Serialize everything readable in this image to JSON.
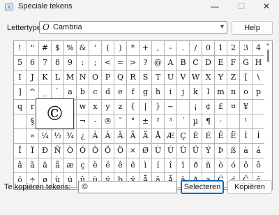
{
  "window": {
    "title": "Speciale tekens",
    "minimize_icon": "minimize-icon",
    "maximize_icon": "maximize-icon",
    "close_icon": "close-icon"
  },
  "font": {
    "label": "Lettertype:",
    "value": "Cambria",
    "font_type_glyph": "O",
    "dropdown_icon": "chevron-down-icon"
  },
  "help": {
    "label": "Help"
  },
  "grid": {
    "columns": 20,
    "rows": [
      [
        "!",
        "\"",
        "#",
        "$",
        "%",
        "&",
        "'",
        "(",
        ")",
        "*",
        "+",
        ",",
        "-",
        ".",
        "/",
        "0",
        "1",
        "2",
        "3",
        "4"
      ],
      [
        "5",
        "6",
        "7",
        "8",
        "9",
        ":",
        ";",
        "<",
        "=",
        ">",
        "?",
        "@",
        "A",
        "B",
        "C",
        "D",
        "E",
        "F",
        "G",
        "H"
      ],
      [
        "I",
        "J",
        "K",
        "L",
        "M",
        "N",
        "O",
        "P",
        "Q",
        "R",
        "S",
        "T",
        "U",
        "V",
        "W",
        "X",
        "Y",
        "Z",
        "[",
        "\\"
      ],
      [
        "]",
        "^",
        "_",
        "`",
        "a",
        "b",
        "c",
        "d",
        "e",
        "f",
        "g",
        "h",
        "i",
        "j",
        "k",
        "l",
        "m",
        "n",
        "o",
        "p"
      ],
      [
        "q",
        "r",
        "",
        "",
        "v",
        "w",
        "x",
        "y",
        "z",
        "{",
        "|",
        "}",
        "~",
        "",
        "¡",
        "¢",
        "£",
        "¤",
        "¥",
        ""
      ],
      [
        "",
        "§",
        "",
        "",
        "«",
        "¬",
        "-",
        "®",
        "¯",
        "°",
        "±",
        "²",
        "³",
        "´",
        "µ",
        "¶",
        "·",
        "",
        "¹",
        ""
      ],
      [
        "",
        "»",
        "¼",
        "½",
        "¾",
        "¿",
        "À",
        "Á",
        "Â",
        "Ã",
        "Ä",
        "Å",
        "Æ",
        "Ç",
        "È",
        "É",
        "Ê",
        "Ë",
        "Ì",
        "Í"
      ],
      [
        "Î",
        "Ï",
        "Ð",
        "Ñ",
        "Ò",
        "Ó",
        "Ô",
        "Õ",
        "Ö",
        "×",
        "Ø",
        "Ù",
        "Ú",
        "Û",
        "Ü",
        "Ý",
        "Þ",
        "ß",
        "à",
        "á"
      ],
      [
        "â",
        "ã",
        "ä",
        "å",
        "æ",
        "ç",
        "è",
        "é",
        "ê",
        "ë",
        "ì",
        "í",
        "î",
        "ï",
        "ð",
        "ñ",
        "ò",
        "ó",
        "ô",
        "õ"
      ],
      [
        "ö",
        "÷",
        "ø",
        "ù",
        "ú",
        "û",
        "ü",
        "ý",
        "þ",
        "ÿ",
        "Ā",
        "ā",
        "Ă",
        "ă",
        "Ą",
        "ą",
        "Ć",
        "ć",
        "Ĉ",
        "ĉ"
      ]
    ],
    "magnified_char": "©",
    "scroll_up_icon": "arrow-up-icon",
    "scroll_down_icon": "arrow-down-icon"
  },
  "copy": {
    "label": "Te kopiëren tekens:",
    "value": "©"
  },
  "buttons": {
    "select": "Selecteren",
    "copy": "Kopiëren"
  },
  "colors": {
    "accent": "#0067c0",
    "window_bg": "#f3f3f3"
  }
}
